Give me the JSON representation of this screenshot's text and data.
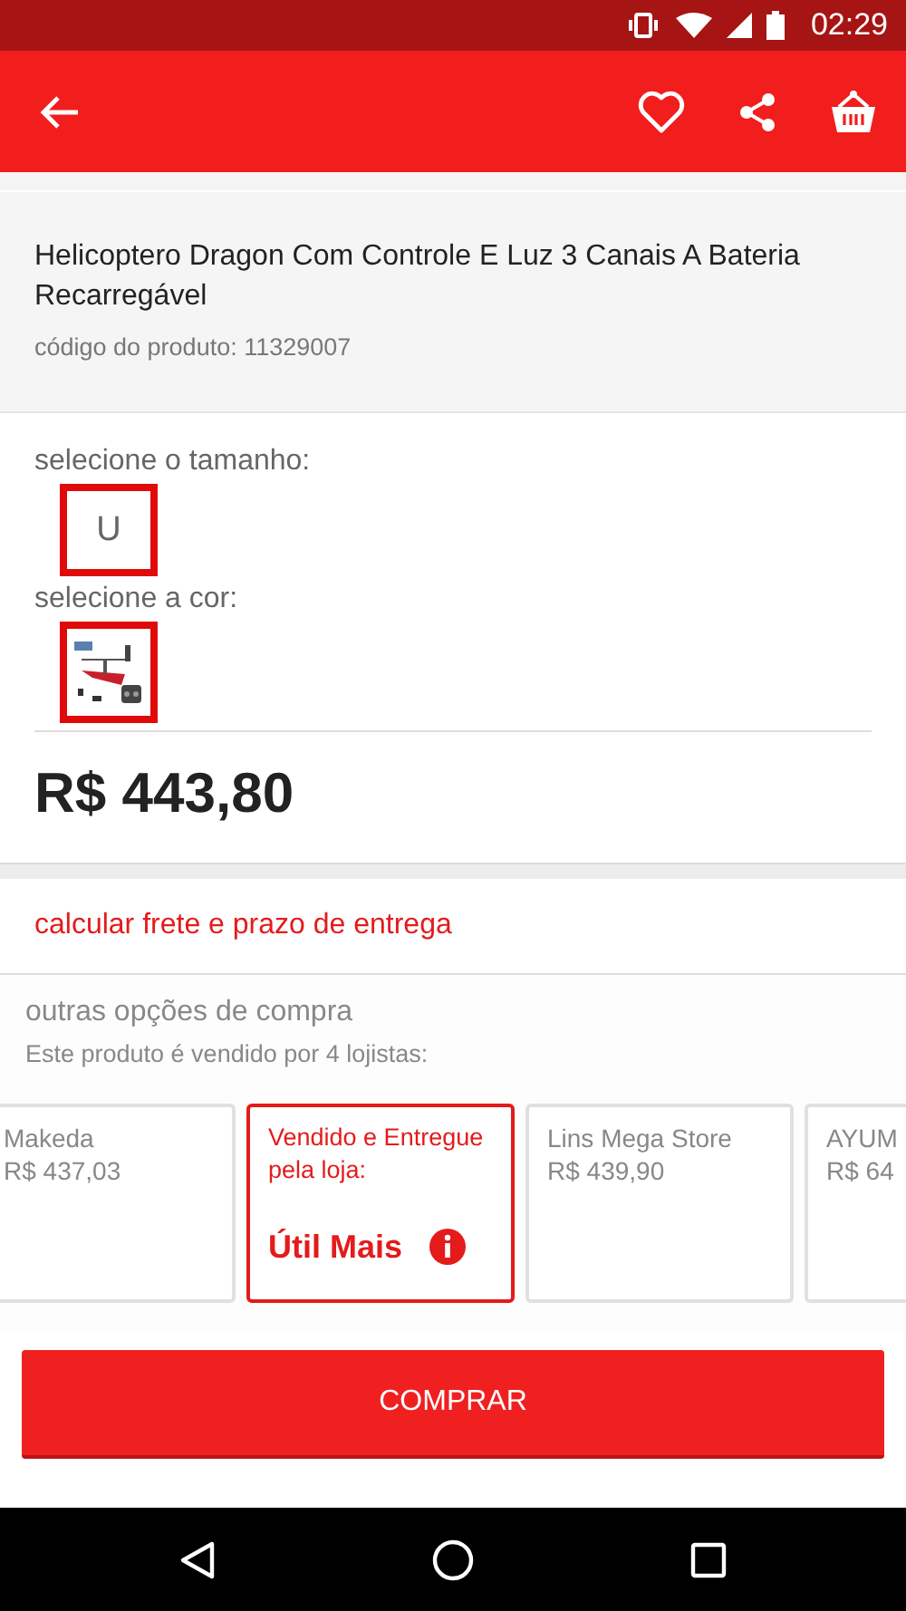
{
  "status_bar": {
    "time": "02:29"
  },
  "product": {
    "title": "Helicoptero Dragon Com Controle E Luz 3 Canais A Bateria Recarregável",
    "code": "código do produto: 11329007"
  },
  "size": {
    "label": "selecione o tamanho:",
    "options": [
      {
        "label": "U",
        "selected": true
      }
    ]
  },
  "color": {
    "label": "selecione a cor:",
    "options": [
      {
        "kind": "picture",
        "selected": true
      }
    ]
  },
  "price": "R$ 443,80",
  "shipping_link": "calcular frete e prazo de entrega",
  "other_offers": {
    "title": "outras opções de compra",
    "subtitle": "Este produto é vendido por 4 lojistas:",
    "sellers": [
      {
        "kind": "offer",
        "selected": false,
        "name": "Makeda",
        "price": "R$ 437,03"
      },
      {
        "kind": "featured",
        "selected": true,
        "label": "Vendido e Entregue pela loja:",
        "name": "Útil Mais"
      },
      {
        "kind": "offer",
        "selected": false,
        "name": "Lins Mega Store",
        "price": "R$ 439,90"
      },
      {
        "kind": "offer",
        "selected": false,
        "name": "AYUM",
        "price": "R$ 64"
      }
    ]
  },
  "buy_button": "COMPRAR"
}
